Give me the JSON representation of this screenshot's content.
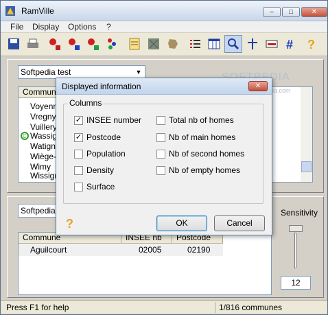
{
  "app": {
    "title": "RamVille"
  },
  "window_controls": {
    "minimize": "–",
    "maximize": "□",
    "close": "✕"
  },
  "menu": [
    {
      "label": "File"
    },
    {
      "label": "Display"
    },
    {
      "label": "Options"
    },
    {
      "label": "?"
    }
  ],
  "toolbar": {
    "buttons": [
      {
        "icon": "save-icon"
      },
      {
        "icon": "print-icon"
      },
      {
        "icon": "flag-d-icon"
      },
      {
        "icon": "flag-r-icon"
      },
      {
        "icon": "flag-p-icon"
      },
      {
        "icon": "sort-icon"
      },
      {
        "icon": "notepad-icon"
      },
      {
        "icon": "map-icon"
      },
      {
        "icon": "france-icon"
      },
      {
        "icon": "list-icon"
      },
      {
        "icon": "table-icon"
      },
      {
        "icon": "search-icon"
      },
      {
        "icon": "pin-icon"
      },
      {
        "icon": "window-icon"
      },
      {
        "icon": "hash-icon"
      },
      {
        "icon": "help-icon"
      }
    ]
  },
  "top_pane": {
    "combo_value": "Softpedia test",
    "list_header": "Commune",
    "rows": [
      "Voyenne",
      "Vregny",
      "Vuillery",
      "Wassign",
      "Watigny",
      "Wiège-F",
      "Wimy",
      "Wissign"
    ],
    "marked_row_index": 3
  },
  "bottom_pane": {
    "combo_value": "Softpedia",
    "headers": [
      "Commune",
      "INSEE nb",
      "Postcode"
    ],
    "rows": [
      {
        "commune": "Aguilcourt",
        "insee": "02005",
        "postcode": "02190"
      }
    ],
    "sensitivity_label": "Sensitivity",
    "sensitivity_value": "12"
  },
  "watermark": {
    "line1": "SOFTPEDIA",
    "line2": "www.softpedia.com"
  },
  "dialog": {
    "title": "Displayed information",
    "group_label": "Columns",
    "left_options": [
      {
        "label": "INSEE number",
        "checked": true
      },
      {
        "label": "Postcode",
        "checked": true
      },
      {
        "label": "Population",
        "checked": false
      },
      {
        "label": "Density",
        "checked": false
      },
      {
        "label": "Surface",
        "checked": false
      }
    ],
    "right_options": [
      {
        "label": "Total nb of homes",
        "checked": false
      },
      {
        "label": "Nb of main homes",
        "checked": false
      },
      {
        "label": "Nb of second homes",
        "checked": false
      },
      {
        "label": "Nb of empty homes",
        "checked": false
      }
    ],
    "ok_label": "OK",
    "cancel_label": "Cancel",
    "help_glyph": "?"
  },
  "status": {
    "left": "Press F1 for help",
    "right": "1/816 communes"
  }
}
